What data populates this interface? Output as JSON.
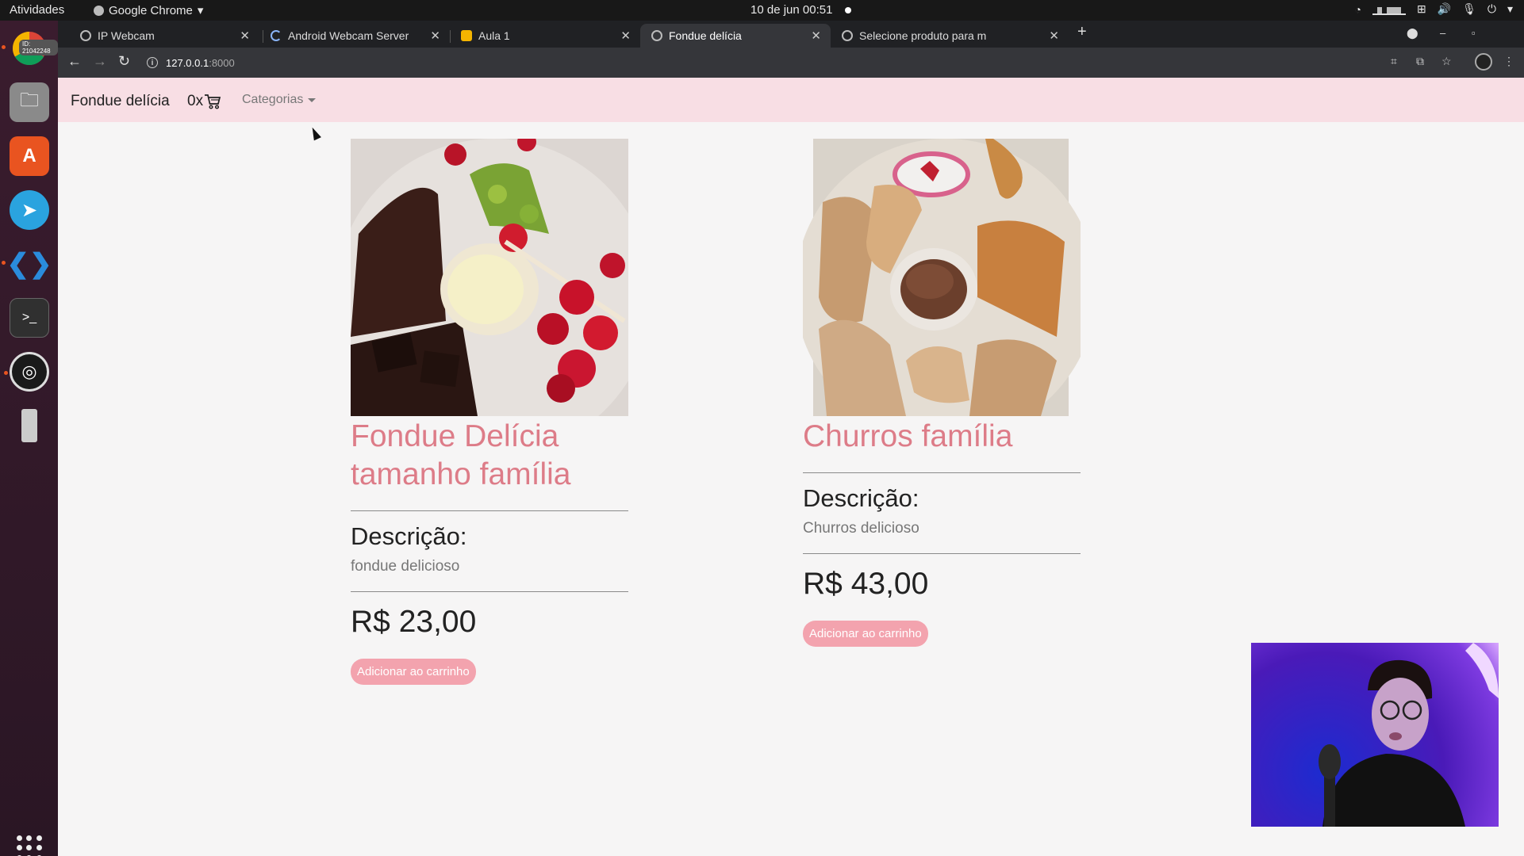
{
  "os": {
    "activities": "Atividades",
    "app_menu": "Google Chrome",
    "clock": "10 de jun  00:51",
    "dock_badge": "ID: 21042248"
  },
  "browser": {
    "tabs": [
      {
        "title": "IP Webcam",
        "active": false
      },
      {
        "title": "Android Webcam Server",
        "active": false
      },
      {
        "title": "Aula 1",
        "active": false
      },
      {
        "title": "Fondue delícia",
        "active": true
      },
      {
        "title": "Selecione produto para m",
        "active": false
      }
    ],
    "url_host": "127.0.0.1",
    "url_port": ":8000"
  },
  "navbar": {
    "brand": "Fondue delícia",
    "cart_count": "0x",
    "categories": "Categorias"
  },
  "products": [
    {
      "name": "Fondue Delícia tamanho família",
      "desc_label": "Descrição:",
      "description": "fondue delicioso",
      "price": "R$ 23,00",
      "button": "Adicionar ao carrinho"
    },
    {
      "name": "Churros família",
      "desc_label": "Descrição:",
      "description": "Churros delicioso",
      "price": "R$ 43,00",
      "button": "Adicionar ao carrinho"
    }
  ],
  "colors": {
    "navbar_bg": "#f8dee4",
    "product_title": "#dd7c88",
    "button_bg": "#f3a3ae",
    "page_bg": "#f6f5f5"
  }
}
